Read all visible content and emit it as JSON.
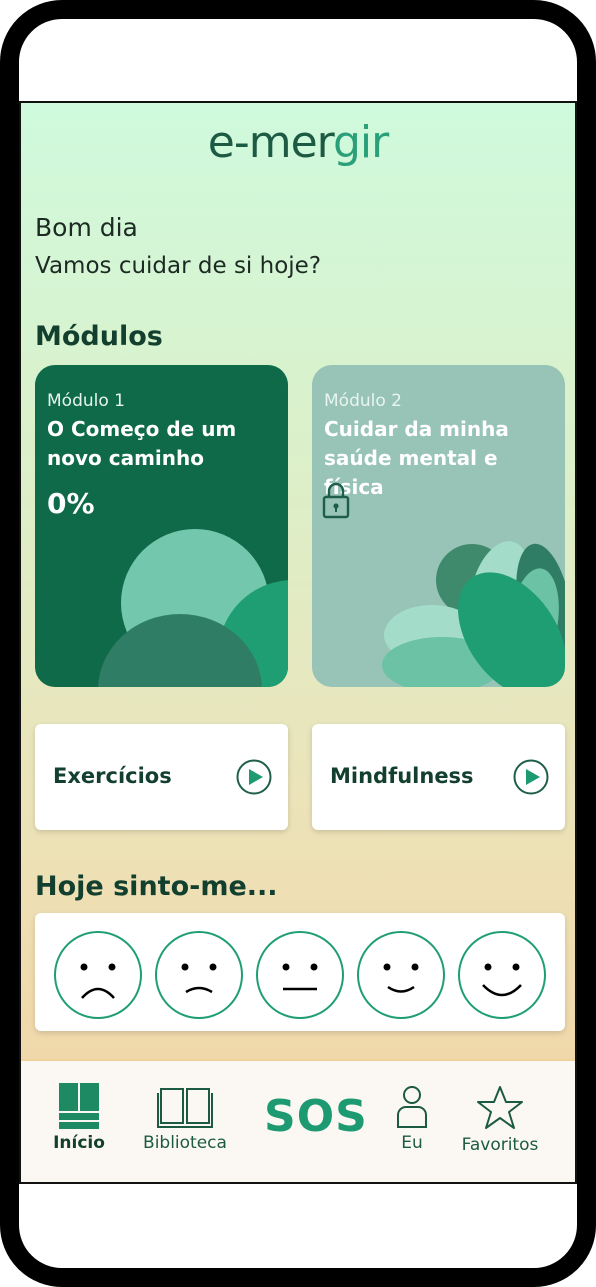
{
  "brand": {
    "logo_part1": "e-mer",
    "logo_part2": "gir"
  },
  "greeting": {
    "line1": "Bom dia",
    "line2": "Vamos cuidar de si hoje?"
  },
  "modules": {
    "title": "Módulos",
    "items": [
      {
        "number": "Módulo 1",
        "name": "O Começo de um novo caminho",
        "progress": "0%",
        "locked": false,
        "color": "#0f6a4a"
      },
      {
        "number": "Módulo 2",
        "name": "Cuidar da minha saúde mental e física",
        "locked": true,
        "color": "#98c3b7"
      }
    ]
  },
  "actions": [
    {
      "label": "Exercícios",
      "icon": "play-icon"
    },
    {
      "label": "Mindfulness",
      "icon": "play-icon"
    }
  ],
  "mood": {
    "title": "Hoje sinto-me...",
    "faces": [
      "very-sad-face-icon",
      "sad-face-icon",
      "neutral-face-icon",
      "happy-face-icon",
      "very-happy-face-icon"
    ]
  },
  "nav": {
    "items": [
      {
        "label": "Início",
        "icon": "home-icon",
        "active": true
      },
      {
        "label": "Biblioteca",
        "icon": "book-icon",
        "active": false
      },
      {
        "label": "SOS",
        "icon": "",
        "active": false
      },
      {
        "label": "Eu",
        "icon": "user-icon",
        "active": false
      },
      {
        "label": "Favoritos",
        "icon": "star-icon",
        "active": false
      }
    ]
  },
  "colors": {
    "accent": "#2aa07a",
    "dark_green": "#133f2f",
    "module1": "#0f6a4a",
    "module2": "#98c3b7"
  }
}
